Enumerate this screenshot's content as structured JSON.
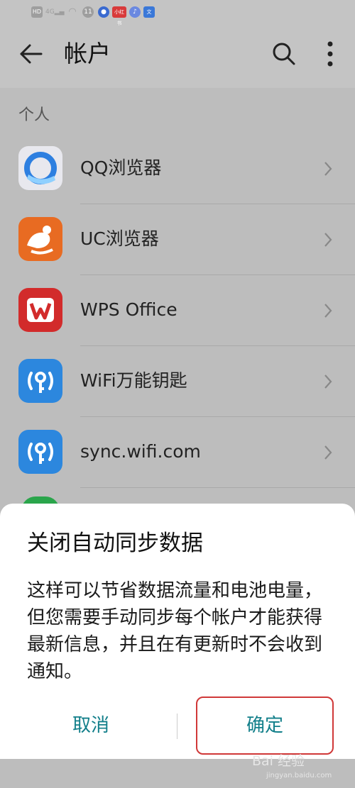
{
  "status_bar": {
    "left_icons": [
      "HD",
      "4G",
      "wifi-icon",
      "11",
      "app1",
      "app2",
      "app3",
      "app4"
    ]
  },
  "header": {
    "title": "帐户",
    "back_icon": "arrow-left-icon",
    "search_icon": "search-icon",
    "more_icon": "more-vertical-icon"
  },
  "accounts": {
    "section_label": "个人",
    "items": [
      {
        "label": "QQ浏览器",
        "icon": "qq-browser-icon"
      },
      {
        "label": "UC浏览器",
        "icon": "uc-browser-icon"
      },
      {
        "label": "WPS Office",
        "icon": "wps-office-icon"
      },
      {
        "label": "WiFi万能钥匙",
        "icon": "wifi-key-icon"
      },
      {
        "label": "sync.wifi.com",
        "icon": "wifi-key-icon"
      }
    ]
  },
  "dialog": {
    "title": "关闭自动同步数据",
    "message": "这样可以节省数据流量和电池电量，但您需要手动同步每个帐户才能获得最新信息，并且在有更新时不会收到通知。",
    "cancel_label": "取消",
    "confirm_label": "确定"
  },
  "watermark": {
    "text": "Bai 经验",
    "sub": "jingyan.baidu.com"
  },
  "colors": {
    "accent": "#127f8a",
    "highlight_box": "#d03838"
  }
}
